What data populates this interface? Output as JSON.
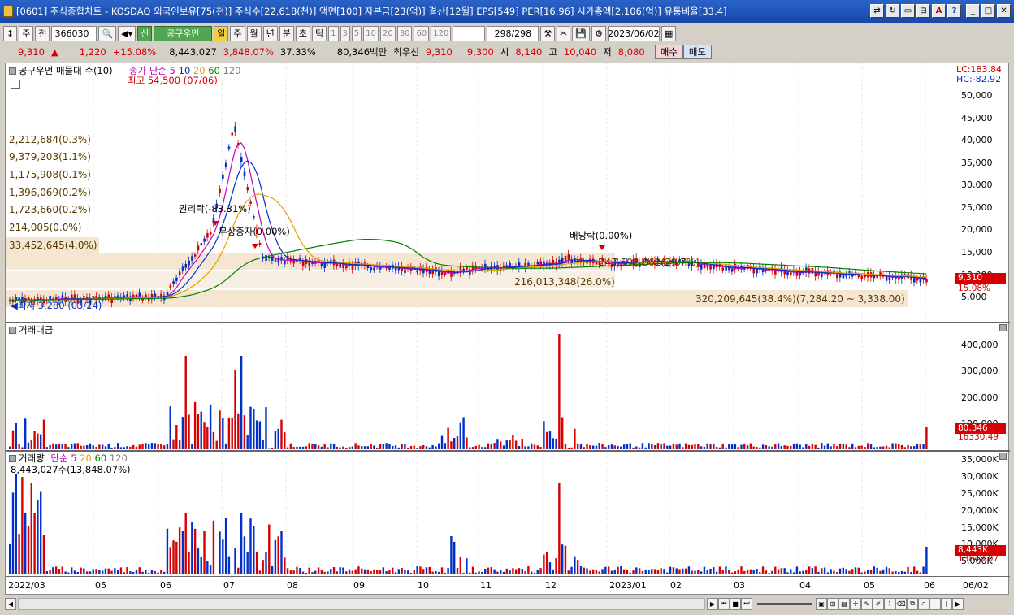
{
  "window": {
    "title": "[0601] 주식종합차트 - KOSDAQ 외국인보유[75(천)] 주식수[22,618(천)] 액면[100] 자본금[23(억)] 결산[12월] EPS[549] PER[16.96] 시가총액[2,106(억)] 유통비율[33.4]"
  },
  "toolbar": {
    "type_select": "주",
    "jeon_label": "전",
    "code": "366030",
    "stock_name": "공구우먼",
    "new_badge": "신",
    "period_il": "일",
    "period_ju": "주",
    "period_wol": "월",
    "period_nyeon": "년",
    "period_bun": "분",
    "period_cho": "초",
    "period_tik": "틱",
    "intervals": [
      "1",
      "3",
      "5",
      "10",
      "20",
      "30",
      "60",
      "120"
    ],
    "count": "298",
    "count_total": "/298",
    "date": "2023/06/02"
  },
  "quote": {
    "price": "9,310",
    "arrow": "▲",
    "change": "1,220",
    "change_pct": "+15.08%",
    "volume": "8,443,027",
    "volume_ratio": "3,848.07%",
    "turnover": "37.33%",
    "amount": "80,346백만",
    "best_label": "최우선",
    "best_ask": "9,310",
    "best_bid": "9,300",
    "open_label": "시",
    "open": "8,140",
    "high_label": "고",
    "high": "10,040",
    "low_label": "저",
    "low": "8,080",
    "buy_button": "매수",
    "sell_button": "매도"
  },
  "price_panel": {
    "title": "공구우먼 매물대 수(10)",
    "ma_label": "종가 단순",
    "ma_periods": [
      "5",
      "10",
      "20",
      "60",
      "120"
    ],
    "lc": "LC:183.84",
    "hc": "HC:-82.92",
    "high_annotation": "최고 54,500 (07/06)",
    "low_annotation": "최저 3,280 (03/24)",
    "event_rights": "권리락(-83.31%)",
    "event_bonus": "무상증자(0.00%)",
    "event_dividend": "배당락(0.00%)",
    "profile_labels": [
      "2,212,684(0.3%)",
      "9,379,203(1.1%)",
      "1,175,908(0.1%)",
      "1,396,069(0.2%)",
      "1,723,660(0.2%)",
      "214,005(0.0%)",
      "33,452,645(4.0%)"
    ],
    "profile_mid1": "247,592,862(29.7%)",
    "profile_mid2": "216,013,348(26.0%)",
    "profile_bottom": "320,209,645(38.4%)(7,284.20 ~ 3,338.00)",
    "y_ticks": [
      "50,000",
      "45,000",
      "40,000",
      "35,000",
      "30,000",
      "25,000",
      "20,000",
      "15,000",
      "10,000",
      "5,000"
    ],
    "tag_price": "9,310",
    "tag_pct": "15.08%"
  },
  "amount_panel": {
    "title": "거래대금",
    "y_ticks": [
      "400,000",
      "300,000",
      "200,000",
      "100,000"
    ],
    "tag_value": "80,346",
    "tag_ma": "16330.49"
  },
  "volume_panel": {
    "title": "거래량",
    "ma_label": "단순",
    "ma_periods": [
      "5",
      "20",
      "60",
      "120"
    ],
    "volume_info": "8,443,027주(13,848.07%)",
    "y_ticks": [
      "35,000K",
      "30,000K",
      "25,000K",
      "20,000K",
      "15,000K",
      "10,000K",
      "5,000K"
    ],
    "tag_value": "8,443K",
    "tag_ma": "13848.07"
  },
  "x_axis": {
    "labels": [
      "2022/03",
      "05",
      "06",
      "07",
      "08",
      "09",
      "10",
      "11",
      "12",
      "2023/01",
      "02",
      "03",
      "04",
      "05",
      "06",
      "06/02"
    ]
  },
  "colors": {
    "up": "#d60000",
    "down": "#0030c8",
    "ma5": "#c000c0",
    "ma10": "#0030c8",
    "ma20": "#e0a000",
    "ma60": "#008000",
    "ma120": "#808080"
  }
}
